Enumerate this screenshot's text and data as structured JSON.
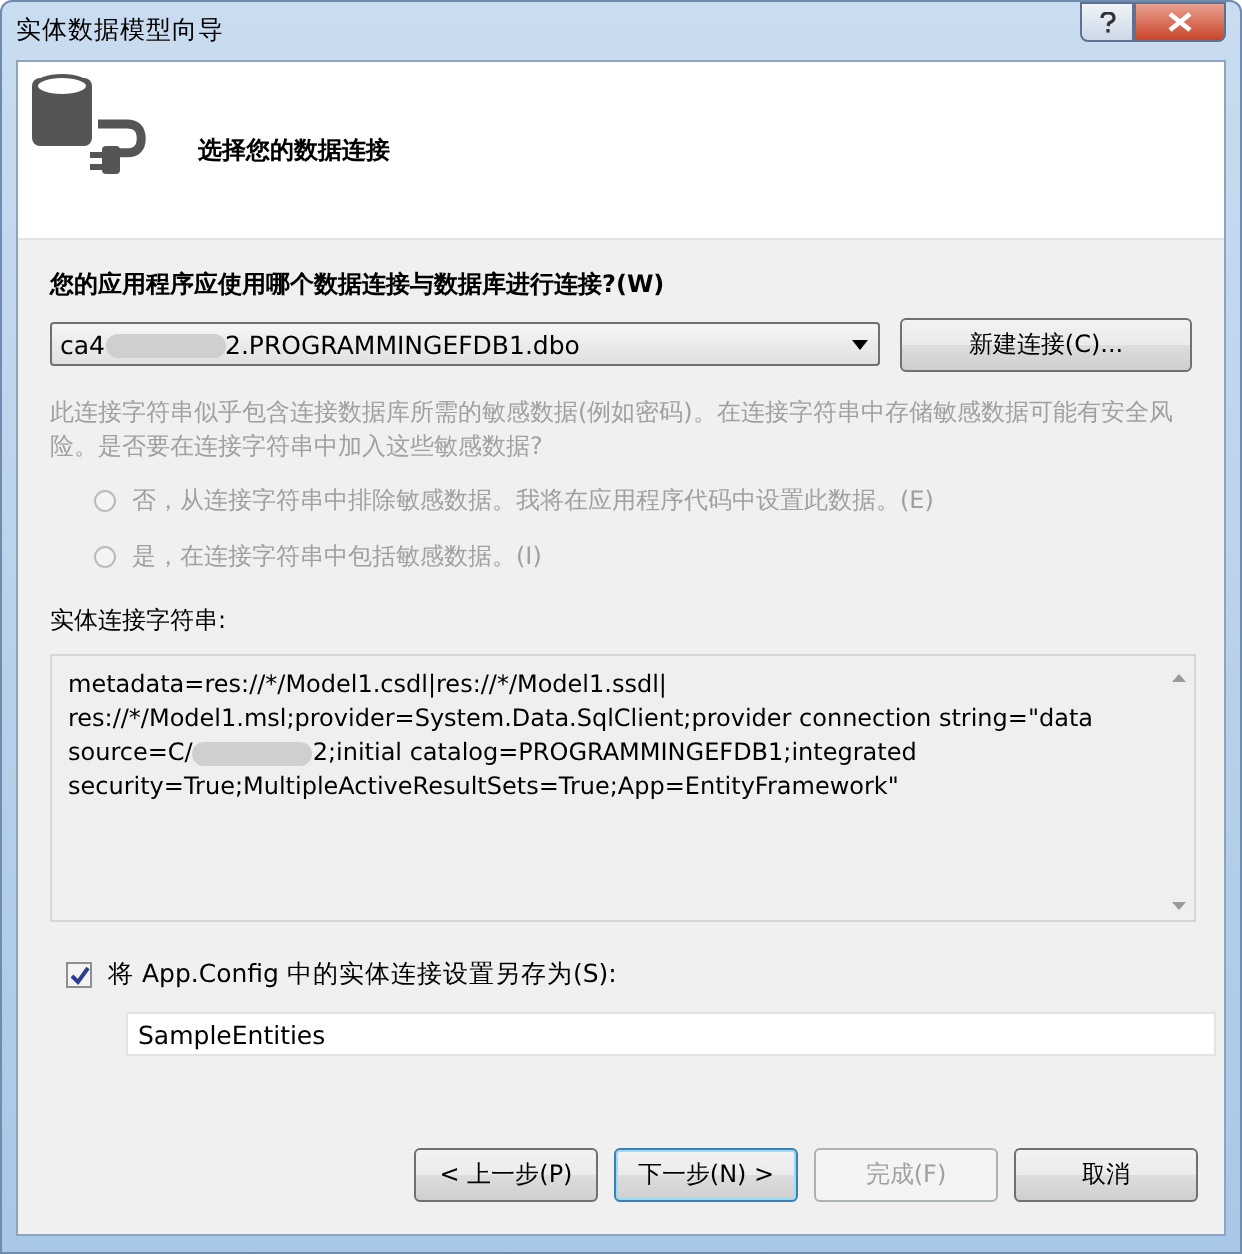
{
  "window": {
    "title": "实体数据模型向导"
  },
  "header": {
    "title": "选择您的数据连接"
  },
  "question": "您的应用程序应使用哪个数据连接与数据库进行连接?(W)",
  "connection": {
    "value_parts": [
      "ca4",
      "2.PROGRAMMINGEFDB1.dbo"
    ]
  },
  "new_connection_button": "新建连接(C)...",
  "warning": "此连接字符串似乎包含连接数据库所需的敏感数据(例如密码)。在连接字符串中存储敏感数据可能有安全风险。是否要在连接字符串中加入这些敏感数据?",
  "options": [
    {
      "label": "否，从连接字符串中排除敏感数据。我将在应用程序代码中设置此数据。(E)",
      "selected": false,
      "disabled": true
    },
    {
      "label": "是，在连接字符串中包括敏感数据。(I)",
      "selected": false,
      "disabled": true
    }
  ],
  "entity_string": {
    "label": "实体连接字符串:",
    "lines": [
      {
        "parts": [
          "metadata=res://*/Model1.csdl|res://*/Model1.ssdl|"
        ]
      },
      {
        "parts": [
          "res://*/Model1.msl;provider=System.Data.SqlClient;provider connection string=\"data"
        ]
      },
      {
        "parts": [
          "source=C/",
          "2;initial catalog=PROGRAMMINGEFDB1;integrated"
        ]
      },
      {
        "parts": [
          "security=True;MultipleActiveResultSets=True;App=EntityFramework\""
        ]
      }
    ]
  },
  "save": {
    "label": "将 App.Config 中的实体连接设置另存为(S):",
    "checked": true,
    "value": "SampleEntities"
  },
  "buttons": [
    {
      "label": "< 上一步(P)",
      "kind": "normal",
      "disabled": false
    },
    {
      "label": "下一步(N) >",
      "kind": "default",
      "disabled": false
    },
    {
      "label": "完成(F)",
      "kind": "normal",
      "disabled": true
    },
    {
      "label": "取消",
      "kind": "normal",
      "disabled": false
    }
  ]
}
